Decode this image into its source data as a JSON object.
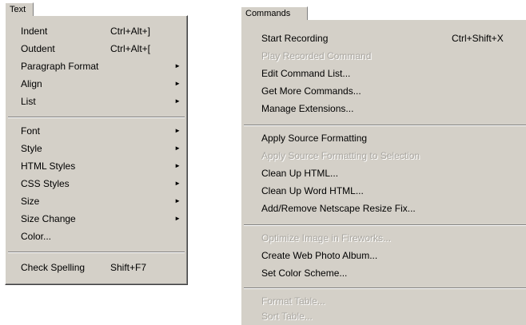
{
  "text_menu": {
    "title": "Text",
    "items": [
      {
        "label": "Indent",
        "shortcut": "Ctrl+Alt+]"
      },
      {
        "label": "Outdent",
        "shortcut": "Ctrl+Alt+["
      },
      {
        "label": "Paragraph Format"
      },
      {
        "label": "Align"
      },
      {
        "label": "List"
      },
      {
        "label": "Font"
      },
      {
        "label": "Style"
      },
      {
        "label": "HTML Styles"
      },
      {
        "label": "CSS Styles"
      },
      {
        "label": "Size"
      },
      {
        "label": "Size Change"
      },
      {
        "label": "Color..."
      },
      {
        "label": "Check Spelling",
        "shortcut": "Shift+F7"
      }
    ],
    "submenu_arrow": "►"
  },
  "commands_menu": {
    "title": "Commands",
    "items": [
      {
        "label": "Start Recording",
        "shortcut": "Ctrl+Shift+X"
      },
      {
        "label": "Play Recorded Command"
      },
      {
        "label": "Edit Command List..."
      },
      {
        "label": "Get More Commands..."
      },
      {
        "label": "Manage Extensions..."
      },
      {
        "label": "Apply Source Formatting"
      },
      {
        "label": "Apply Source Formatting to Selection"
      },
      {
        "label": "Clean Up HTML..."
      },
      {
        "label": "Clean Up Word HTML..."
      },
      {
        "label": "Add/Remove Netscape Resize Fix..."
      },
      {
        "label": "Optimize Image in Fireworks..."
      },
      {
        "label": "Create Web Photo Album..."
      },
      {
        "label": "Set Color Scheme..."
      },
      {
        "label": "Format Table..."
      },
      {
        "label": "Sort Table..."
      }
    ]
  },
  "colors": {
    "menu_face": "#d4d0c8",
    "disabled_text": "#a9a6a0",
    "highlight": "#ffffff",
    "shadow": "#808080"
  }
}
